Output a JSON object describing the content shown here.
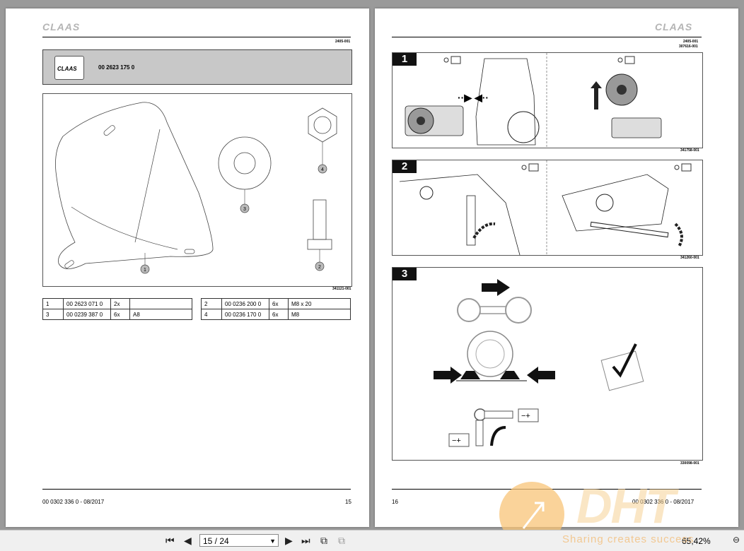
{
  "left_page": {
    "logo": "CLAAS",
    "ref_code": "2405-001",
    "part_header": {
      "icon_label": "CLAAS",
      "part_number": "00 2623 175 0"
    },
    "callouts": [
      "1",
      "2",
      "3",
      "4"
    ],
    "drawing_code": "341121-001",
    "parts_table_left": [
      {
        "pos": "1",
        "part": "00 2623 071 0",
        "qty": "2x",
        "note": ""
      },
      {
        "pos": "3",
        "part": "00 0239 387 0",
        "qty": "6x",
        "note": "A8"
      }
    ],
    "parts_table_right": [
      {
        "pos": "2",
        "part": "00 0236 200 0",
        "qty": "6x",
        "note": "M8 x 20"
      },
      {
        "pos": "4",
        "part": "00 0236 170 0",
        "qty": "6x",
        "note": "M8"
      }
    ],
    "footer_doc": "00 0302 336 0 - 08/2017",
    "page_number": "15"
  },
  "right_page": {
    "logo": "CLAAS",
    "ref_code_1": "2405-001",
    "ref_code_2": "307616-001",
    "steps": [
      {
        "number": "1",
        "code": "341758-001"
      },
      {
        "number": "2",
        "code": "341260-001"
      },
      {
        "number": "3",
        "code": "330098-001"
      }
    ],
    "footer_doc": "00 0302 336 0 - 08/2017",
    "page_number": "16"
  },
  "toolbar": {
    "page_display": "15 / 24",
    "zoom": "65,42%",
    "icons": [
      "first-page-icon",
      "prev-page-icon",
      "next-page-icon",
      "last-page-icon",
      "two-page-icon",
      "single-page-icon",
      "zoom-out-icon"
    ]
  },
  "watermark": {
    "text": "Sharing creates success",
    "brand": "DHT"
  }
}
